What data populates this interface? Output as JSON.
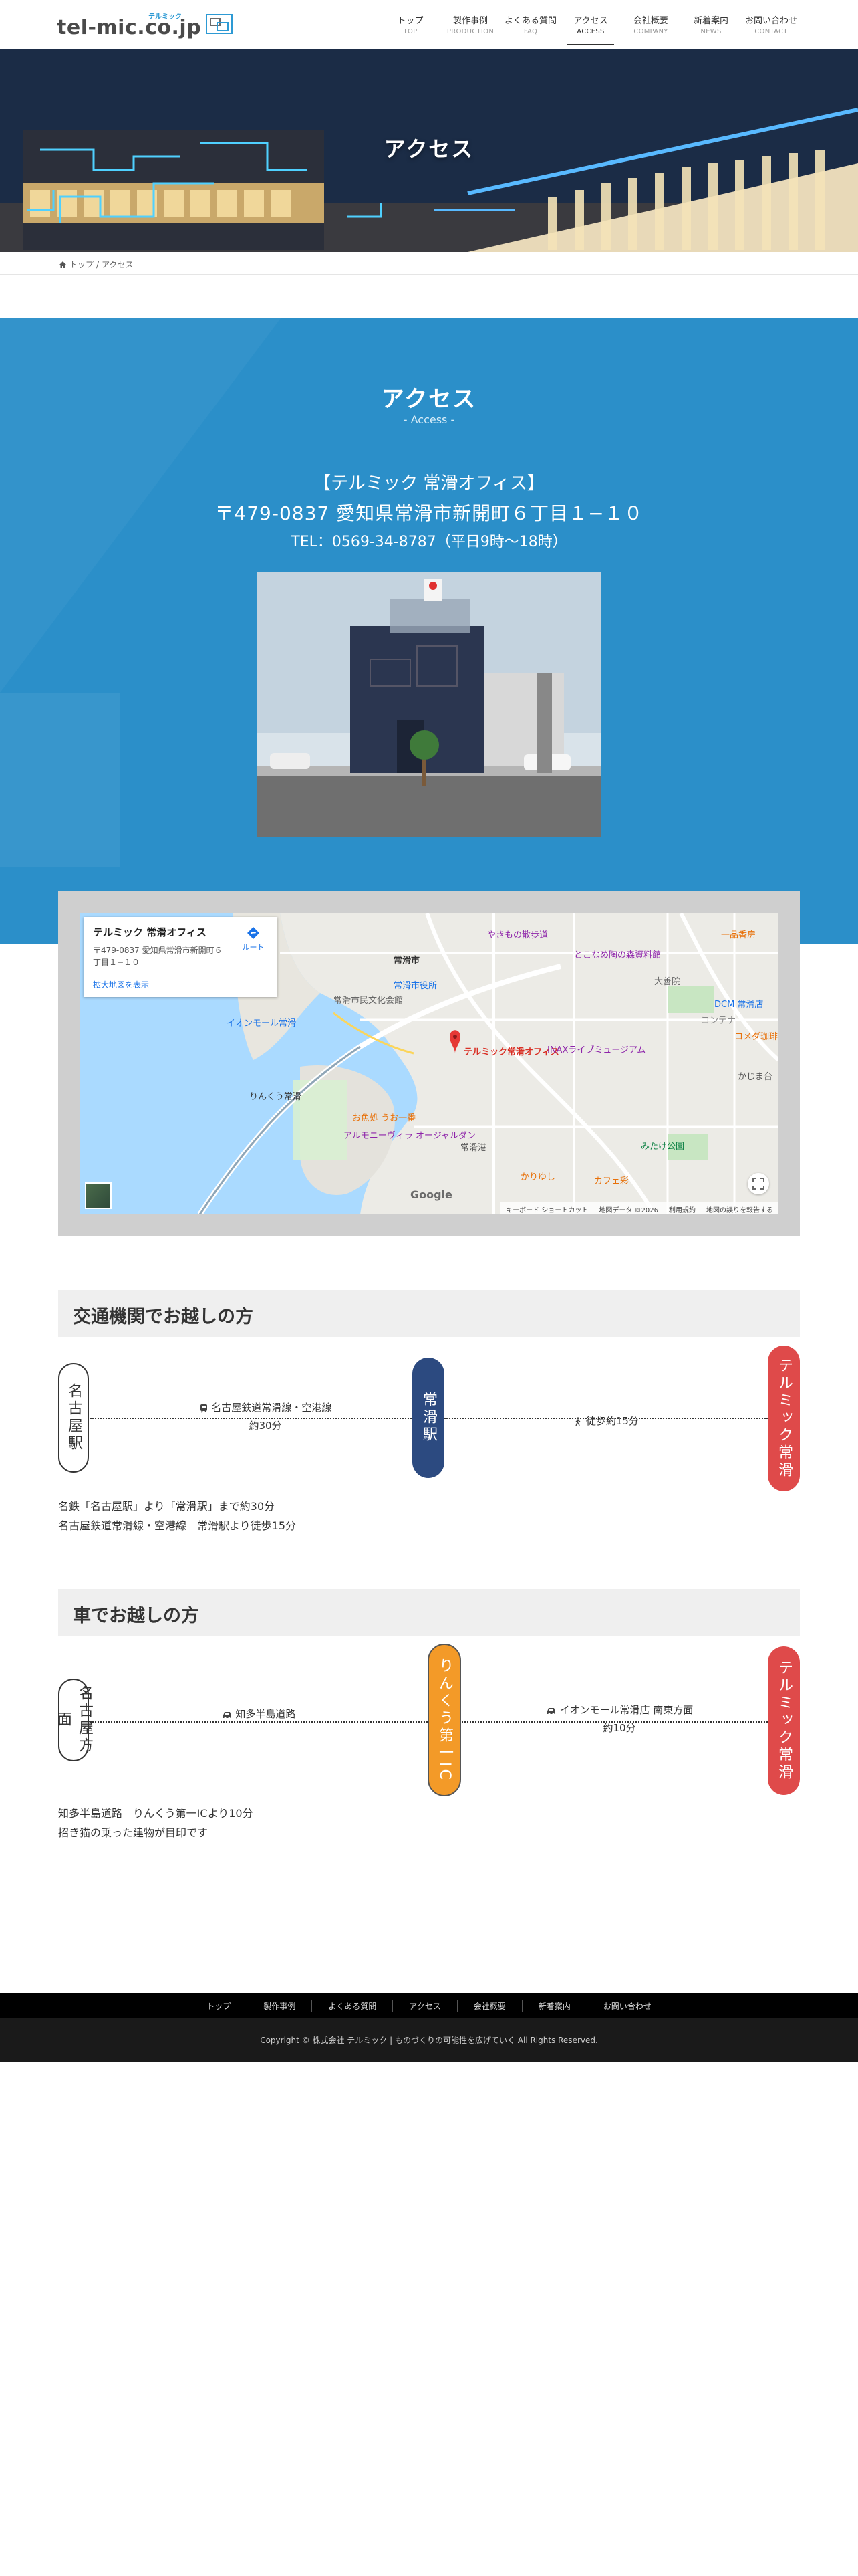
{
  "header": {
    "logo_text": "tel-mic.co.jp",
    "logo_sub": "テルミック",
    "nav": [
      {
        "jp": "トップ",
        "en": "TOP"
      },
      {
        "jp": "製作事例",
        "en": "PRODUCTION"
      },
      {
        "jp": "よくある質問",
        "en": "FAQ"
      },
      {
        "jp": "アクセス",
        "en": "ACCESS"
      },
      {
        "jp": "会社概要",
        "en": "COMPANY"
      },
      {
        "jp": "新着案内",
        "en": "NEWS"
      },
      {
        "jp": "お問い合わせ",
        "en": "CONTACT"
      }
    ]
  },
  "hero": {
    "title": "アクセス"
  },
  "breadcrumb": {
    "home": "トップ",
    "sep": "/",
    "current": "アクセス"
  },
  "access": {
    "title": "アクセス",
    "subtitle": "- Access -",
    "office_name": "【テルミック 常滑オフィス】",
    "address": "〒479-0837 愛知県常滑市新開町６丁目１−１０",
    "tel": "TEL：0569-34-8787（平日9時〜18時）"
  },
  "map": {
    "card_title": "テルミック 常滑オフィス",
    "card_address": "〒479-0837 愛知県常滑市新開町６丁目１−１０",
    "route_label": "ルート",
    "enlarge_link": "拡大地図を表示",
    "marker_label": "テルミック常滑オフィス",
    "labels": [
      "常滑市",
      "やきもの散歩道",
      "とこなめ陶の森資料館",
      "大善院",
      "DCM 常滑店",
      "一品香房",
      "常滑市役所",
      "常滑市民文化会館",
      "コメダ珈琲店",
      "INAXライブミュージアム",
      "コンテナ",
      "かじま台",
      "イオンモール常滑",
      "りんくう常滑",
      "お魚処 うお一番",
      "アルモニーヴィラ オージャルダン",
      "常滑港",
      "みたけ公園",
      "カフェ彩",
      "かりゆし"
    ],
    "google": "Google",
    "footer": [
      "キーボード ショートカット",
      "地図データ ©2026",
      "利用規約",
      "地図の誤りを報告する"
    ]
  },
  "transit": {
    "heading": "交通機関でお越しの方",
    "start": "名古屋駅",
    "middle": "常滑駅",
    "end": "テルミック常滑",
    "seg1_label": "名古屋鉄道常滑線・空港線",
    "seg1_time": "約30分",
    "seg2_label": "徒歩約15分",
    "note1": "名鉄「名古屋駅」より「常滑駅」まで約30分",
    "note2": "名古屋鉄道常滑線・空港線　常滑駅より徒歩15分"
  },
  "car": {
    "heading": "車でお越しの方",
    "start": "名古屋方面",
    "middle": "りんくう第一IC",
    "end": "テルミック常滑",
    "seg1_label": "知多半島道路",
    "seg2_label": "イオンモール常滑店 南東方面",
    "seg2_time": "約10分",
    "note1": "知多半島道路　りんくう第一ICより10分",
    "note2": "招き猫の乗った建物が目印です"
  },
  "footer": {
    "nav": [
      "トップ",
      "製作事例",
      "よくある質問",
      "アクセス",
      "会社概要",
      "新着案内",
      "お問い合わせ"
    ],
    "copyright": "Copyright © 株式会社 テルミック | ものづくりの可能性を広げていく All Rights Reserved."
  },
  "colors": {
    "accent_blue": "#2b8fc9",
    "navy": "#2c4a80",
    "red": "#df4a4a",
    "orange": "#f39a28"
  }
}
